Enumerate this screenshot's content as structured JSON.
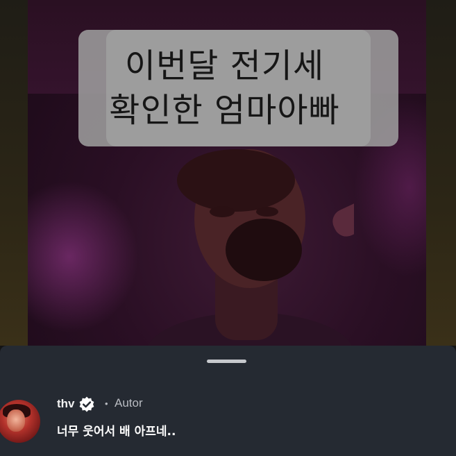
{
  "video": {
    "caption_line1": "이번달 전기세",
    "caption_line2": "확인한 엄마아빠"
  },
  "comment_sheet": {
    "username": "thv",
    "verified_icon": "verified-badge-icon",
    "separator": "•",
    "author_tag": "Autor",
    "comment_text": "너무 웃어서 배 아프네.."
  },
  "colors": {
    "sheet_background": "#252a32",
    "handle": "#c7c9cd",
    "caption_background": "#a0a0a0"
  }
}
